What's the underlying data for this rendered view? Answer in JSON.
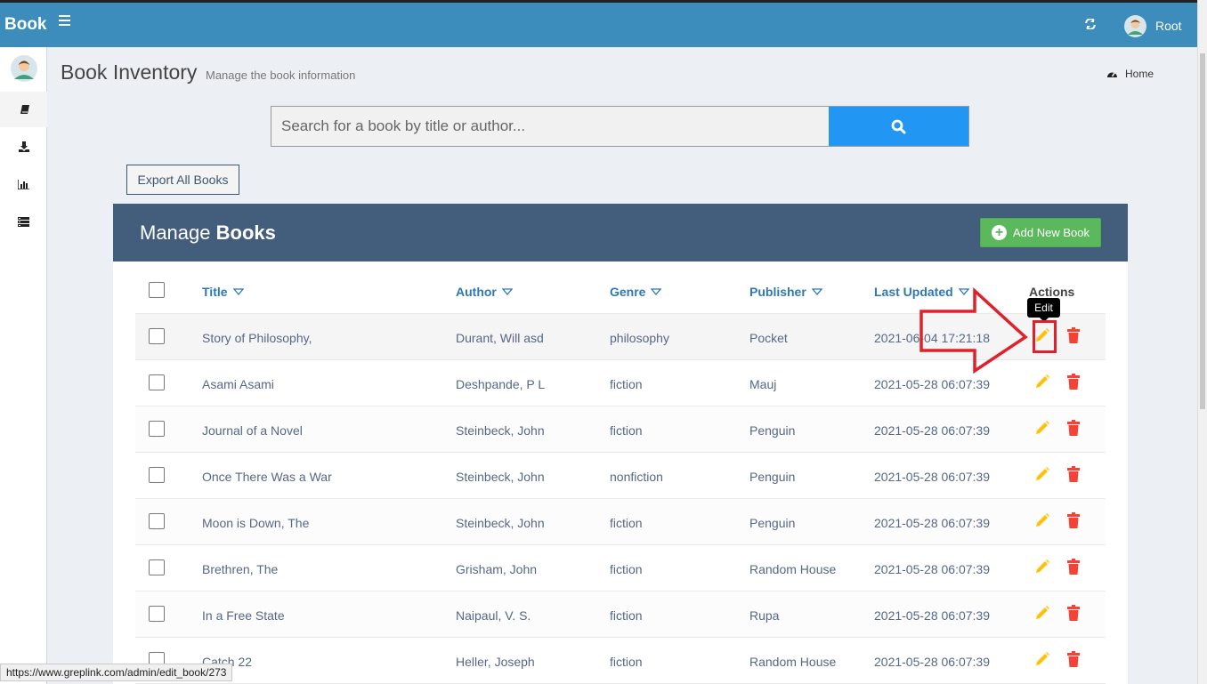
{
  "app": {
    "brand": "Book",
    "user_name": "Root"
  },
  "header": {
    "title": "Book Inventory",
    "subtitle": "Manage the book information",
    "home_label": "Home"
  },
  "search": {
    "placeholder": "Search for a book by title or author..."
  },
  "export_label": "Export All Books",
  "panel": {
    "title_prefix": "Manage",
    "title_bold": "Books",
    "add_label": "Add New Book"
  },
  "table": {
    "columns": [
      "Title",
      "Author",
      "Genre",
      "Publisher",
      "Last Updated",
      "Actions"
    ],
    "rows": [
      {
        "title": "Story of Philosophy,",
        "author": "Durant, Will asd",
        "genre": "philosophy",
        "publisher": "Pocket",
        "updated": "2021-06-04 17:21:18"
      },
      {
        "title": "Asami Asami",
        "author": "Deshpande, P L",
        "genre": "fiction",
        "publisher": "Mauj",
        "updated": "2021-05-28 06:07:39"
      },
      {
        "title": "Journal of a Novel",
        "author": "Steinbeck, John",
        "genre": "fiction",
        "publisher": "Penguin",
        "updated": "2021-05-28 06:07:39"
      },
      {
        "title": "Once There Was a War",
        "author": "Steinbeck, John",
        "genre": "nonfiction",
        "publisher": "Penguin",
        "updated": "2021-05-28 06:07:39"
      },
      {
        "title": "Moon is Down, The",
        "author": "Steinbeck, John",
        "genre": "fiction",
        "publisher": "Penguin",
        "updated": "2021-05-28 06:07:39"
      },
      {
        "title": "Brethren, The",
        "author": "Grisham, John",
        "genre": "fiction",
        "publisher": "Random House",
        "updated": "2021-05-28 06:07:39"
      },
      {
        "title": "In a Free State",
        "author": "Naipaul, V. S.",
        "genre": "fiction",
        "publisher": "Rupa",
        "updated": "2021-05-28 06:07:39"
      },
      {
        "title": "Catch 22",
        "author": "Heller, Joseph",
        "genre": "fiction",
        "publisher": "Random House",
        "updated": "2021-05-28 06:07:39"
      }
    ]
  },
  "tooltip": "Edit",
  "status_url": "https://www.greplink.com/admin/edit_book/273",
  "colors": {
    "topbar": "#3c8dbc",
    "panel_header": "#435d7d",
    "search_button": "#2196f3",
    "add_button": "#5cb85c",
    "edit_icon": "#ffc107",
    "delete_icon": "#f44336",
    "annotation": "#e0202a"
  },
  "icons": {
    "menu": "hamburger-icon",
    "refresh": "refresh-icon",
    "search": "search-icon",
    "home": "dashboard-icon",
    "edit": "pencil-icon",
    "delete": "trash-icon",
    "sort": "chevron-down-icon"
  }
}
